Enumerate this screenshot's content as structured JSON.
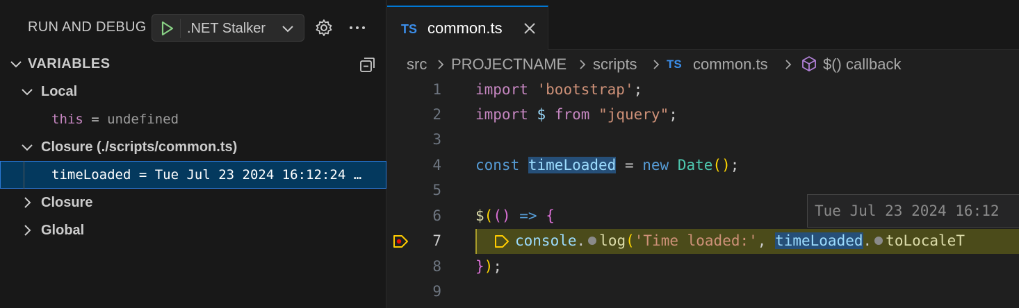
{
  "debug": {
    "title": "RUN AND DEBUG",
    "config_name": ".NET Stalker",
    "variables_header": "VARIABLES",
    "scopes": {
      "local": "Local",
      "closure_file": "Closure (./scripts/common.ts)",
      "closure": "Closure",
      "global": "Global"
    },
    "vars": {
      "this_name": "this",
      "this_eq": " = ",
      "this_value": "undefined",
      "timeLoaded_name": "timeLoaded",
      "timeLoaded_eq": " = ",
      "timeLoaded_value": "Tue Jul 23 2024 16:12:24 …"
    }
  },
  "editor": {
    "tab": {
      "lang_badge": "TS",
      "filename": "common.ts"
    },
    "breadcrumb": {
      "src": "src",
      "project": "PROJECTNAME",
      "scripts": "scripts",
      "ts_badge": "TS",
      "file": "common.ts",
      "symbol": "$() callback"
    },
    "line_numbers": [
      "1",
      "2",
      "3",
      "4",
      "5",
      "6",
      "7",
      "8",
      "9"
    ],
    "code": {
      "l1_import": "import",
      "l1_str": "'bootstrap'",
      "l1_end": ";",
      "l2_import": "import",
      "l2_dollar": "$",
      "l2_from": "from",
      "l2_str": "\"jquery\"",
      "l2_end": ";",
      "l4_const": "const",
      "l4_var": "timeLoaded",
      "l4_eq": " = ",
      "l4_new": "new",
      "l4_date": "Date",
      "l4_paren": "()",
      "l4_end": ";",
      "l6_dollar": "$",
      "l6_open": "(",
      "l6_params": "()",
      "l6_arrow": "=>",
      "l6_brace": "{",
      "l7_console": "console",
      "l7_dot1": ".",
      "l7_log": "log",
      "l7_open": "(",
      "l7_str": "'Time loaded:'",
      "l7_comma": ", ",
      "l7_var": "timeLoaded",
      "l7_dot2": ".",
      "l7_method": "toLocaleT",
      "l8_brace": "}",
      "l8_paren": ")",
      "l8_end": ";"
    },
    "hover_value": "Tue Jul 23 2024 16:12"
  },
  "colors": {
    "accent": "#0078d4",
    "debug_play": "#89d185",
    "current_line": "#4b4b1a",
    "breakpoint_stop": "#ffcc00"
  },
  "icons": [
    "play-icon",
    "chevron-down-icon",
    "gear-icon",
    "more-icon",
    "collapse-all-icon",
    "chevron-right-icon",
    "close-icon",
    "symbol-method-icon",
    "stack-frame-pointer-icon",
    "inline-breakpoint-icon"
  ]
}
